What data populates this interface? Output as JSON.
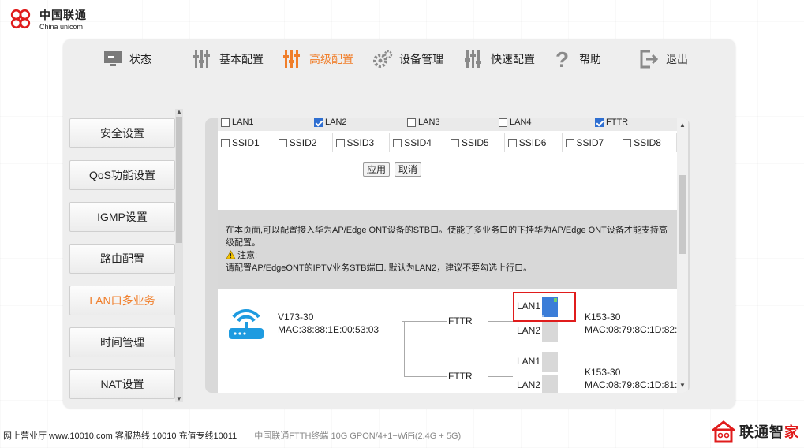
{
  "logo": {
    "cn": "中国联通",
    "en": "China unicom"
  },
  "nav": [
    {
      "label": "状态",
      "icon": "monitor-icon"
    },
    {
      "label": "基本配置",
      "icon": "sliders-icon"
    },
    {
      "label": "高级配置",
      "icon": "sliders-icon",
      "active": true
    },
    {
      "label": "设备管理",
      "icon": "gear-icon"
    },
    {
      "label": "快速配置",
      "icon": "sliders-icon"
    },
    {
      "label": "帮助",
      "icon": "question-icon"
    },
    {
      "label": "退出",
      "icon": "logout-icon"
    }
  ],
  "sidebar": {
    "items": [
      {
        "label": "安全设置"
      },
      {
        "label": "QoS功能设置"
      },
      {
        "label": "IGMP设置"
      },
      {
        "label": "路由配置"
      },
      {
        "label": "LAN口多业务",
        "active": true
      },
      {
        "label": "时间管理"
      },
      {
        "label": "NAT设置"
      }
    ]
  },
  "ports_row": [
    {
      "label": "LAN1",
      "checked": false
    },
    {
      "label": "LAN2",
      "checked": true
    },
    {
      "label": "LAN3",
      "checked": false
    },
    {
      "label": "LAN4",
      "checked": false
    },
    {
      "label": "FTTR",
      "checked": true
    }
  ],
  "ssid_row": [
    {
      "label": "SSID1",
      "checked": false
    },
    {
      "label": "SSID2",
      "checked": false
    },
    {
      "label": "SSID3",
      "checked": false
    },
    {
      "label": "SSID4",
      "checked": false
    },
    {
      "label": "SSID5",
      "checked": false
    },
    {
      "label": "SSID6",
      "checked": false
    },
    {
      "label": "SSID7",
      "checked": false
    },
    {
      "label": "SSID8",
      "checked": false
    }
  ],
  "buttons": {
    "apply": "应用",
    "cancel": "取消"
  },
  "notice": {
    "line1": "在本页面,可以配置接入华为AP/Edge ONT设备的STB口。使能了多业务口的下挂华为AP/Edge ONT设备才能支持高级配置。",
    "warn_label": "注意:",
    "line2": "请配置AP/EdgeONT的IPTV业务STB端口. 默认为LAN2，建议不要勾选上行口。"
  },
  "topology": {
    "main": {
      "name": "V173-30",
      "mac": "MAC:38:88:1E:00:53:03"
    },
    "link1": "FTTR",
    "link2": "FTTR",
    "sub1": {
      "lan_a": "LAN1",
      "lan_b": "LAN2",
      "name": "K153-30",
      "mac": "MAC:08:79:8C:1D:82:"
    },
    "sub2": {
      "lan_a": "LAN1",
      "lan_b": "LAN2",
      "name": "K153-30",
      "mac": "MAC:08:79:8C:1D:81:"
    }
  },
  "footer": {
    "left": "网上营业厅 www.10010.com  客服热线  10010  充值专线10011",
    "device": "中国联通FTTH终端 10G GPON/4+1+WiFi(2.4G + 5G)"
  },
  "brand": {
    "part1": "联通智",
    "part2": "家"
  },
  "colors": {
    "accent": "#f07e2a",
    "brand_red": "#e01c1c",
    "port_blue": "#3b7dd8"
  }
}
